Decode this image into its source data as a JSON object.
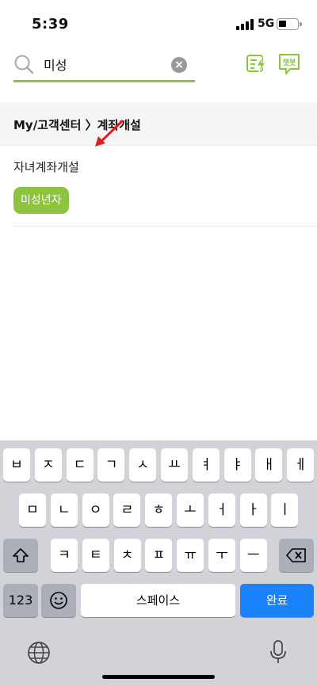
{
  "status": {
    "time": "5:39",
    "network": "5G"
  },
  "search": {
    "query": "미성",
    "clear_glyph": "×"
  },
  "header_icons": [
    {
      "name": "quick-menu-icon"
    },
    {
      "name": "chatbot-icon",
      "label": "챗봇"
    }
  ],
  "results": {
    "section_title": "My/고객센터 〉계좌개설",
    "items": [
      {
        "title": "자녀계좌개설",
        "tag": "미성년자"
      }
    ]
  },
  "keyboard": {
    "row1": [
      "ㅂ",
      "ㅈ",
      "ㄷ",
      "ㄱ",
      "ㅅ",
      "ㅛ",
      "ㅕ",
      "ㅑ",
      "ㅐ",
      "ㅔ"
    ],
    "row2": [
      "ㅁ",
      "ㄴ",
      "ㅇ",
      "ㄹ",
      "ㅎ",
      "ㅗ",
      "ㅓ",
      "ㅏ",
      "ㅣ"
    ],
    "row3": [
      "ㅋ",
      "ㅌ",
      "ㅊ",
      "ㅍ",
      "ㅠ",
      "ㅜ",
      "ㅡ"
    ],
    "numbers_label": "123",
    "space_label": "스페이스",
    "done_label": "완료"
  },
  "colors": {
    "accent": "#8cc43f",
    "done_key": "#1a82fb",
    "annotation_arrow": "#e02020"
  }
}
